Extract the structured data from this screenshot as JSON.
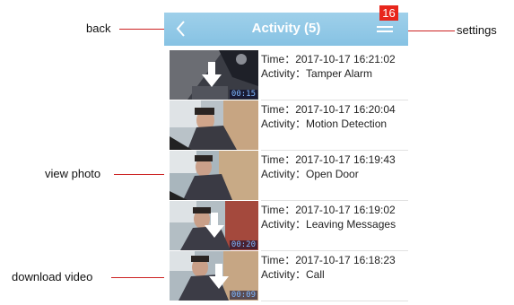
{
  "annotations": {
    "back": "back",
    "settings": "settings",
    "view_photo": "view photo",
    "download_video": "download video",
    "badge": "16"
  },
  "header": {
    "title": "Activity (5)",
    "back_icon": "chevron-left-icon",
    "menu_icon": "hamburger-menu-icon"
  },
  "labels": {
    "time": "Time：",
    "activity": "Activity："
  },
  "events": [
    {
      "time": "2017-10-17 16:21:02",
      "activity": "Tamper Alarm",
      "duration": "00:15",
      "has_video": true
    },
    {
      "time": "2017-10-17 16:20:04",
      "activity": "Motion Detection",
      "duration": "",
      "has_video": false
    },
    {
      "time": "2017-10-17 16:19:43",
      "activity": "Open Door",
      "duration": "",
      "has_video": false
    },
    {
      "time": "2017-10-17 16:19:02",
      "activity": "Leaving Messages",
      "duration": "00:20",
      "has_video": true
    },
    {
      "time": "2017-10-17 16:18:23",
      "activity": "Call",
      "duration": "00:09",
      "has_video": true
    }
  ],
  "colors": {
    "header": "#8ec7e6",
    "leader": "#cc2222",
    "badge": "#e8261c"
  }
}
